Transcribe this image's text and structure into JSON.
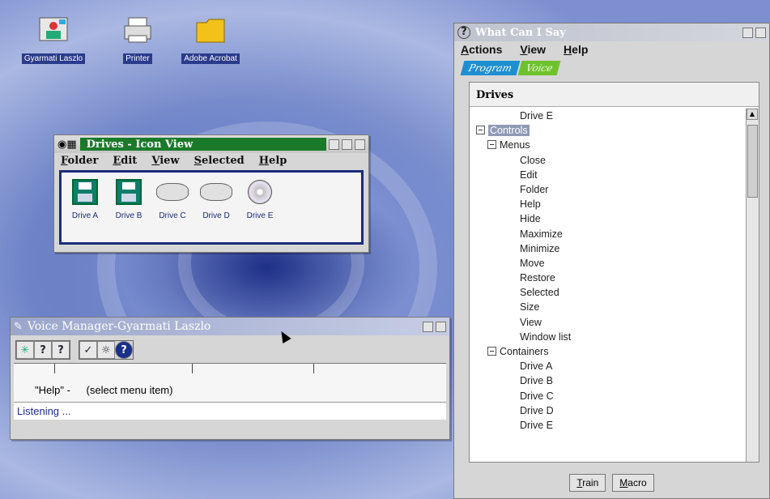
{
  "desktop": {
    "icons": [
      {
        "label": "Gyarmati Laszlo",
        "icon": "user-icon"
      },
      {
        "label": "Printer",
        "icon": "printer-icon"
      },
      {
        "label": "Adobe Acrobat",
        "icon": "folder-icon"
      }
    ]
  },
  "drives_window": {
    "title": "Drives - Icon View",
    "menu": [
      "Folder",
      "Edit",
      "View",
      "Selected",
      "Help"
    ],
    "drives": [
      {
        "label": "Drive A",
        "icon": "floppy-icon"
      },
      {
        "label": "Drive B",
        "icon": "floppy-icon"
      },
      {
        "label": "Drive C",
        "icon": "hard-disk-icon"
      },
      {
        "label": "Drive D",
        "icon": "hard-disk-icon"
      },
      {
        "label": "Drive E",
        "icon": "cd-icon"
      }
    ]
  },
  "voice_manager": {
    "title": "Voice Manager-Gyarmati Laszlo",
    "command": "\"Help\" -",
    "command_desc": "(select menu item)",
    "status": "Listening ..."
  },
  "what_can_i_say": {
    "title": "What Can I Say",
    "menu": [
      "Actions",
      "View",
      "Help"
    ],
    "tabs": [
      "Program",
      "Voice"
    ],
    "panel_header": "Drives",
    "tree": [
      {
        "label": "Drive E",
        "level": 2,
        "exp": false
      },
      {
        "label": "Controls",
        "level": 0,
        "exp": true,
        "selected": true
      },
      {
        "label": "Menus",
        "level": 1,
        "exp": true
      },
      {
        "label": "Close",
        "level": 2
      },
      {
        "label": "Edit",
        "level": 2
      },
      {
        "label": "Folder",
        "level": 2
      },
      {
        "label": "Help",
        "level": 2
      },
      {
        "label": "Hide",
        "level": 2
      },
      {
        "label": "Maximize",
        "level": 2
      },
      {
        "label": "Minimize",
        "level": 2
      },
      {
        "label": "Move",
        "level": 2
      },
      {
        "label": "Restore",
        "level": 2
      },
      {
        "label": "Selected",
        "level": 2
      },
      {
        "label": "Size",
        "level": 2
      },
      {
        "label": "View",
        "level": 2
      },
      {
        "label": "Window list",
        "level": 2
      },
      {
        "label": "Containers",
        "level": 1,
        "exp": true
      },
      {
        "label": "Drive A",
        "level": 2
      },
      {
        "label": "Drive B",
        "level": 2
      },
      {
        "label": "Drive C",
        "level": 2
      },
      {
        "label": "Drive D",
        "level": 2
      },
      {
        "label": "Drive E",
        "level": 2
      }
    ],
    "buttons": [
      "Train",
      "Macro"
    ]
  }
}
